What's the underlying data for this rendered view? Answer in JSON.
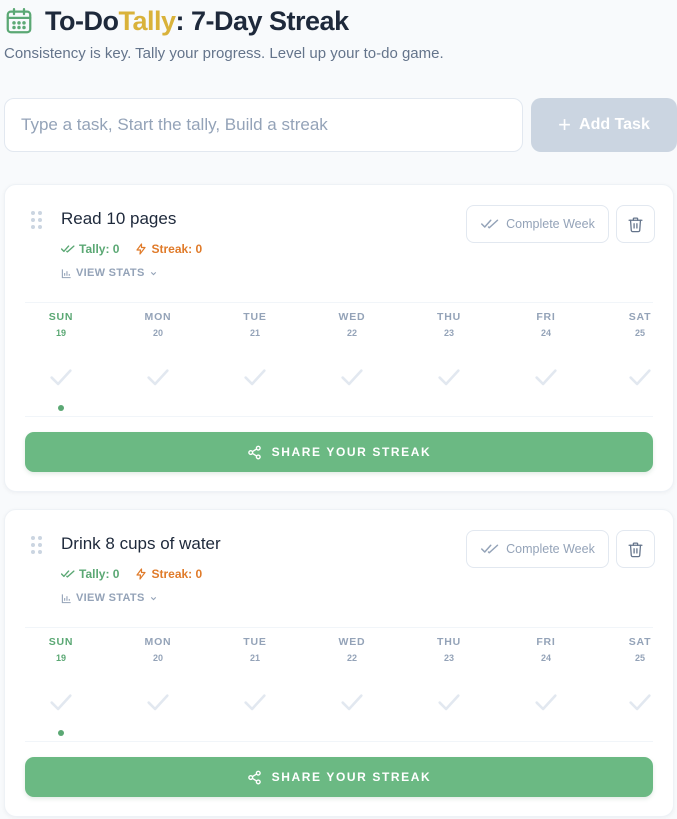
{
  "header": {
    "title_part1": "To-Do",
    "title_accent": "Tally",
    "title_part2": ": 7-Day Streak",
    "subtitle": "Consistency is key. Tally your progress. Level up your to-do game.",
    "icon": "calendar-icon"
  },
  "add_task": {
    "placeholder": "Type a task, Start the tally, Build a streak",
    "value": "",
    "button_label": "Add Task",
    "button_icon": "plus-icon"
  },
  "colors": {
    "accent_gold": "#d9b23a",
    "green": "#5ba874",
    "share_green": "#6bb983",
    "streak_orange": "#e07b2a",
    "disabled_gray": "#cbd5e1"
  },
  "tasks": [
    {
      "name": "Read 10 pages",
      "tally_label": "Tally: 0",
      "streak_label": "Streak: 0",
      "view_stats_label": "VIEW STATS",
      "complete_week_label": "Complete Week",
      "share_label": "SHARE YOUR STREAK",
      "days": [
        {
          "name": "SUN",
          "num": "19",
          "today": true
        },
        {
          "name": "MON",
          "num": "20",
          "today": false
        },
        {
          "name": "TUE",
          "num": "21",
          "today": false
        },
        {
          "name": "WED",
          "num": "22",
          "today": false
        },
        {
          "name": "THU",
          "num": "23",
          "today": false
        },
        {
          "name": "FRI",
          "num": "24",
          "today": false
        },
        {
          "name": "SAT",
          "num": "25",
          "today": false
        }
      ]
    },
    {
      "name": "Drink 8 cups of water",
      "tally_label": "Tally: 0",
      "streak_label": "Streak: 0",
      "view_stats_label": "VIEW STATS",
      "complete_week_label": "Complete Week",
      "share_label": "SHARE YOUR STREAK",
      "days": [
        {
          "name": "SUN",
          "num": "19",
          "today": true
        },
        {
          "name": "MON",
          "num": "20",
          "today": false
        },
        {
          "name": "TUE",
          "num": "21",
          "today": false
        },
        {
          "name": "WED",
          "num": "22",
          "today": false
        },
        {
          "name": "THU",
          "num": "23",
          "today": false
        },
        {
          "name": "FRI",
          "num": "24",
          "today": false
        },
        {
          "name": "SAT",
          "num": "25",
          "today": false
        }
      ]
    }
  ]
}
